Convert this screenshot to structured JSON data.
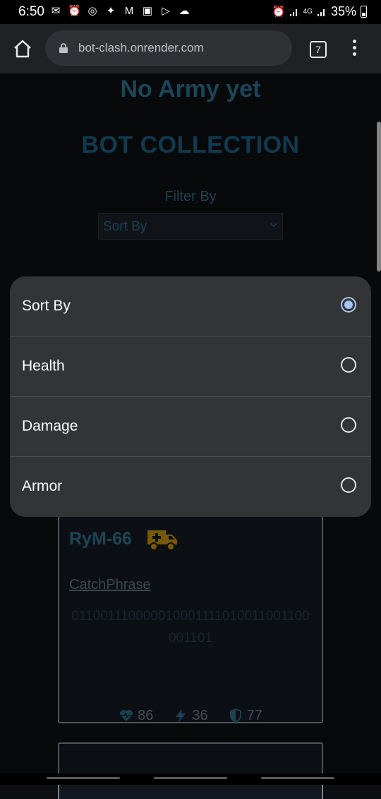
{
  "status_bar": {
    "time": "6:50",
    "network": "4G",
    "battery": "35%"
  },
  "browser": {
    "url": "bot-clash.onrender.com",
    "tab_count": "7"
  },
  "page": {
    "army_heading": "No Army yet",
    "collection_title": "BOT COLLECTION",
    "filter_label": "Filter By",
    "select_value": "Sort By"
  },
  "dialog": {
    "options": [
      {
        "label": "Sort By",
        "selected": true
      },
      {
        "label": "Health",
        "selected": false
      },
      {
        "label": "Damage",
        "selected": false
      },
      {
        "label": "Armor",
        "selected": false
      }
    ]
  },
  "bot_card": {
    "name": "RyM-66",
    "class_icon": "ambulance-icon",
    "catchphrase_label": "CatchPhrase",
    "catchphrase": "011001110000010001111010011001100001101",
    "health": "86",
    "damage": "36",
    "armor": "77"
  },
  "colors": {
    "accent": "#2c6a86",
    "dialog_bg": "#333436",
    "radio_selected": "#a8c4f4",
    "class_icon": "#b8860b"
  }
}
